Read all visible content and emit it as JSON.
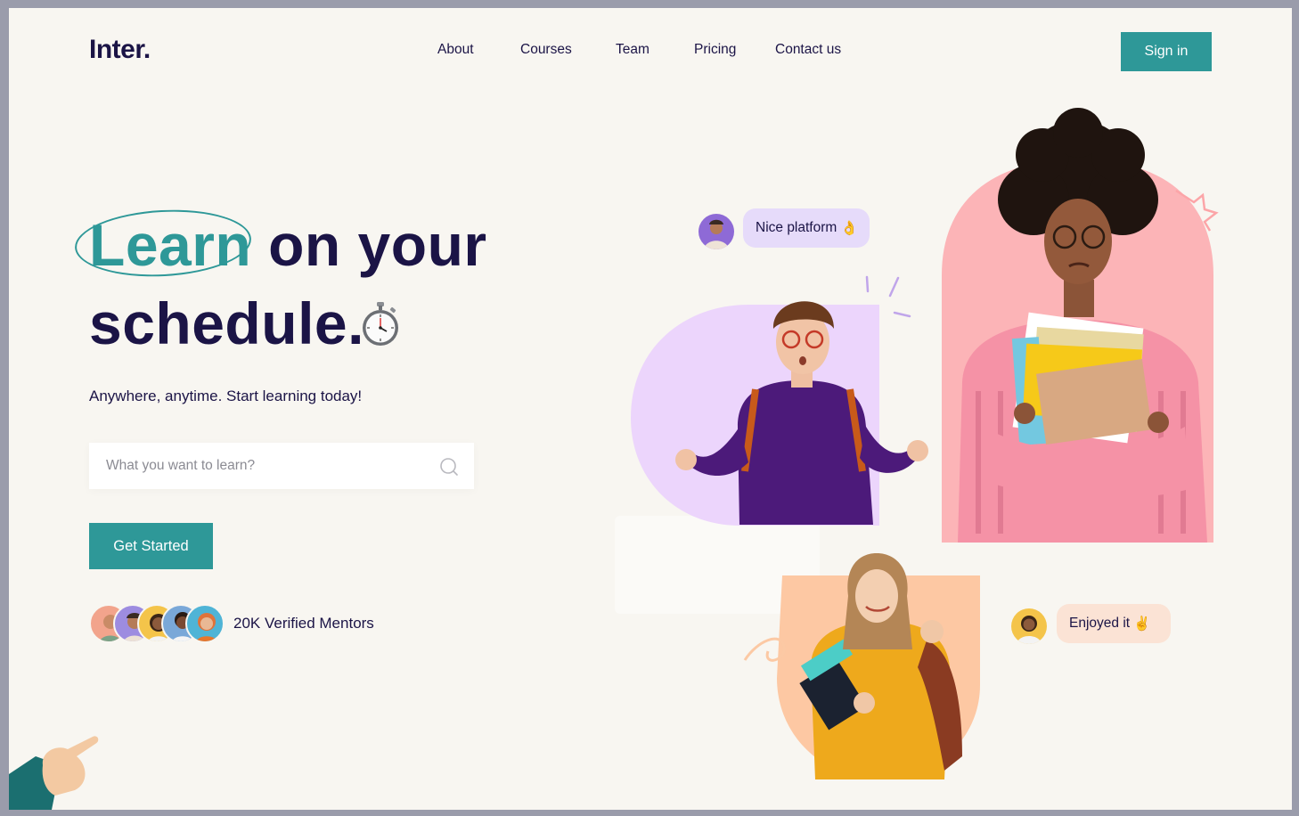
{
  "brand": {
    "logo": "Inter."
  },
  "nav": {
    "items": [
      "About",
      "Courses",
      "Team",
      "Pricing",
      "Contact us"
    ],
    "signin_label": "Sign in"
  },
  "hero": {
    "title_highlight": "Learn",
    "title_rest_line1": "on your",
    "title_line2": "schedule.",
    "subtitle": "Anywhere, anytime. Start learning today!",
    "search_placeholder": "What you want to learn?",
    "cta_label": "Get Started",
    "mentors_label": "20K Verified Mentors"
  },
  "testimonials": [
    {
      "text": "Nice platform",
      "emoji": "👌"
    },
    {
      "text": "Enjoyed it",
      "emoji": "✌️"
    }
  ],
  "colors": {
    "accent": "#2e9898",
    "navy": "#1b1446",
    "background": "#f8f6f1",
    "lavender": "#e6dbfa",
    "pink": "#fcb5b8",
    "peach": "#fcc9a4"
  },
  "icons": [
    "stopwatch-icon",
    "search-icon",
    "pointing-hand-icon"
  ]
}
